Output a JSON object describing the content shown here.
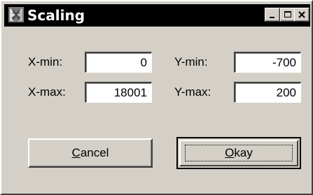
{
  "window": {
    "title": "Scaling"
  },
  "titlebar_buttons": {
    "minimize": "minimize-icon",
    "maximize": "maximize-icon",
    "close": "close-icon"
  },
  "fields": {
    "x_min": {
      "label": "X-min:",
      "value": "0"
    },
    "x_max": {
      "label": "X-max:",
      "value": "18001"
    },
    "y_min": {
      "label": "Y-min:",
      "value": "-700"
    },
    "y_max": {
      "label": "Y-max:",
      "value": "200"
    }
  },
  "buttons": {
    "cancel": {
      "mnemonic": "C",
      "rest": "ancel"
    },
    "okay": {
      "mnemonic": "O",
      "rest": "kay"
    }
  },
  "colors": {
    "face": "#d4d0c8",
    "titlebar": "#000000",
    "title_text": "#ffffff",
    "field_bg": "#ffffff"
  }
}
